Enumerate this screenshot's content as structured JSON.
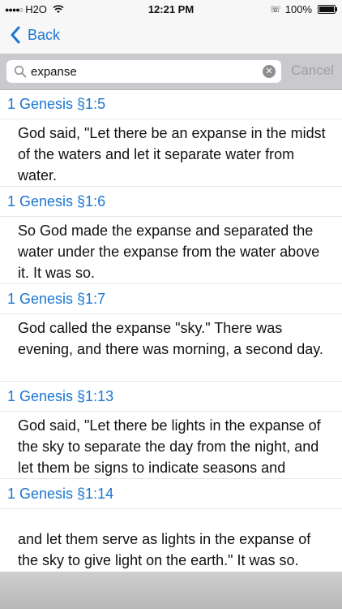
{
  "status_bar": {
    "carrier": "H2O",
    "time": "12:21 PM",
    "battery": "100%"
  },
  "nav": {
    "back_label": "Back"
  },
  "search": {
    "value": "expanse",
    "cancel_label": "Cancel"
  },
  "results": [
    {
      "reference": "1 Genesis §1:5",
      "text": "God said, \"Let there be an expanse in the midst of the waters and let it separate water from water."
    },
    {
      "reference": "1 Genesis §1:6",
      "text": "So God made the expanse and separated the water under the expanse from the water above it. It was so."
    },
    {
      "reference": "1 Genesis §1:7",
      "text": "God called the expanse \"sky.\" There was evening, and there was morning, a second day."
    },
    {
      "reference": "1 Genesis §1:13",
      "text": "God said, \"Let there be lights in the expanse of the sky to separate the day from the night, and let them be signs to indicate seasons and"
    },
    {
      "reference": "1 Genesis §1:14",
      "text": "and let them serve as lights in the expanse of the sky to give light on the earth.\" It was so."
    }
  ],
  "colors": {
    "accent": "#1a76d2",
    "cancel_disabled": "#a0a0a0"
  }
}
